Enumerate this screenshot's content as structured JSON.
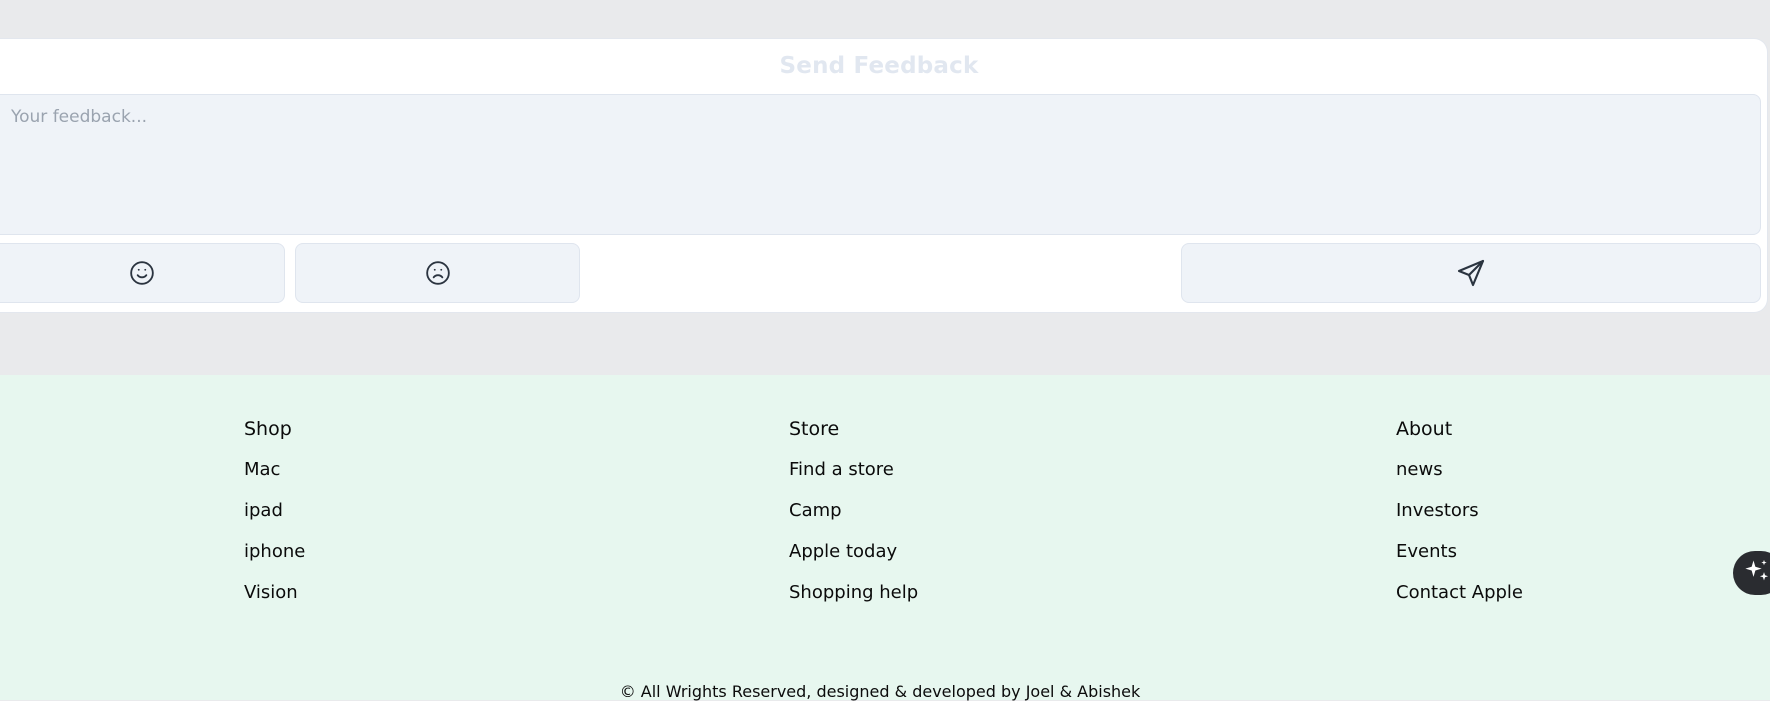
{
  "feedback": {
    "title": "Send Feedback",
    "placeholder": "Your feedback...",
    "value": ""
  },
  "icons": {
    "happy": "smile-icon",
    "sad": "frown-icon",
    "send": "send-icon",
    "assistant": "sparkles-icon"
  },
  "footer": {
    "columns": [
      {
        "heading": "Shop",
        "links": [
          "Mac",
          "ipad",
          "iphone",
          "Vision"
        ]
      },
      {
        "heading": "Store",
        "links": [
          "Find a store",
          "Camp",
          "Apple today",
          "Shopping help"
        ]
      },
      {
        "heading": "About",
        "links": [
          "news",
          "Investors",
          "Events",
          "Contact Apple"
        ]
      }
    ],
    "copyright": "© All Wrights Reserved, designed & developed by Joel & Abishek"
  },
  "colors": {
    "page_bg": "#e9eaec",
    "footer_bg": "#e7f7ef",
    "input_bg": "#eff3f8",
    "title": "#e1e7f0",
    "icon": "#2b3440"
  }
}
